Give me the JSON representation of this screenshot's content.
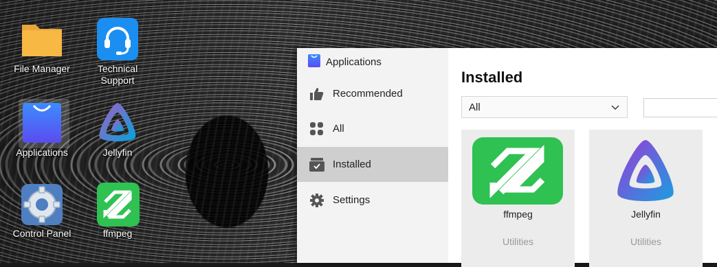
{
  "desktop": {
    "icons": [
      {
        "label": "File Manager",
        "icon": "folder-icon"
      },
      {
        "label": "Technical Support",
        "icon": "headset-icon"
      },
      {
        "label": "Applications",
        "icon": "shopping-bag-icon"
      },
      {
        "label": "Jellyfin",
        "icon": "jellyfin-icon"
      },
      {
        "label": "Control Panel",
        "icon": "gear-icon"
      },
      {
        "label": "ffmpeg",
        "icon": "ffmpeg-icon"
      }
    ]
  },
  "window": {
    "title": "Applications",
    "nav": [
      {
        "label": "Recommended",
        "icon": "thumbs-up-icon"
      },
      {
        "label": "All",
        "icon": "grid-icon"
      },
      {
        "label": "Installed",
        "icon": "installed-box-icon",
        "active": true
      },
      {
        "label": "Settings",
        "icon": "gear-icon"
      }
    ],
    "heading": "Installed",
    "filter": {
      "selected": "All"
    },
    "search": {
      "value": ""
    },
    "apps": [
      {
        "name": "ffmpeg",
        "category": "Utilities",
        "icon": "ffmpeg-icon"
      },
      {
        "name": "Jellyfin",
        "category": "Utilities",
        "icon": "jellyfin-icon"
      }
    ]
  },
  "colors": {
    "sidebar_bg": "#f3f3f3",
    "active_nav": "#cfcfcf",
    "card_bg": "#ececec",
    "ffmpeg_green": "#2fc152",
    "jellyfin_purple": "#9b3bd6",
    "jellyfin_blue": "#1c9de0",
    "folder_orange": "#f7b844",
    "support_blue": "#1b8ef1"
  }
}
